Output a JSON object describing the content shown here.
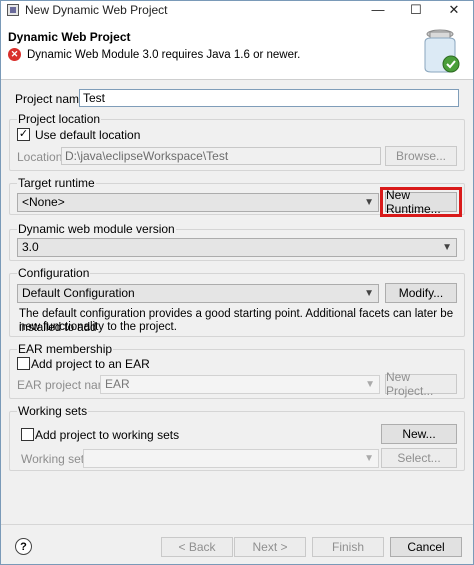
{
  "window": {
    "title": "New Dynamic Web Project",
    "minimize_glyph": "—",
    "maximize_glyph": "☐",
    "close_glyph": "✕"
  },
  "header": {
    "title": "Dynamic Web Project",
    "error_message": "Dynamic Web Module 3.0 requires Java 1.6 or newer.",
    "error_icon": "error-icon",
    "banner_icon": "jar-icon"
  },
  "project": {
    "name_label": "Project name:",
    "name_value": "Test"
  },
  "location": {
    "group_title": "Project location",
    "use_default_label": "Use default location",
    "use_default_checked": true,
    "location_label": "Location:",
    "location_value": "D:\\java\\eclipseWorkspace\\Test",
    "browse_label": "Browse..."
  },
  "runtime": {
    "group_title": "Target runtime",
    "selected": "<None>",
    "new_runtime_label": "New Runtime..."
  },
  "module": {
    "group_title": "Dynamic web module version",
    "selected": "3.0"
  },
  "configuration": {
    "group_title": "Configuration",
    "selected": "Default Configuration",
    "modify_label": "Modify...",
    "description_line1": "The default configuration provides a good starting point. Additional facets can later be installed to add",
    "description_line2": "new functionality to the project."
  },
  "ear": {
    "group_title": "EAR membership",
    "add_label": "Add project to an EAR",
    "add_checked": false,
    "name_label": "EAR project name:",
    "name_value": "EAR",
    "new_project_label": "New Project..."
  },
  "working_sets": {
    "group_title": "Working sets",
    "add_label": "Add project to working sets",
    "add_checked": false,
    "new_label": "New...",
    "sets_label": "Working sets:",
    "select_label": "Select..."
  },
  "footer": {
    "help_glyph": "?",
    "back_label": "< Back",
    "next_label": "Next >",
    "finish_label": "Finish",
    "cancel_label": "Cancel"
  }
}
